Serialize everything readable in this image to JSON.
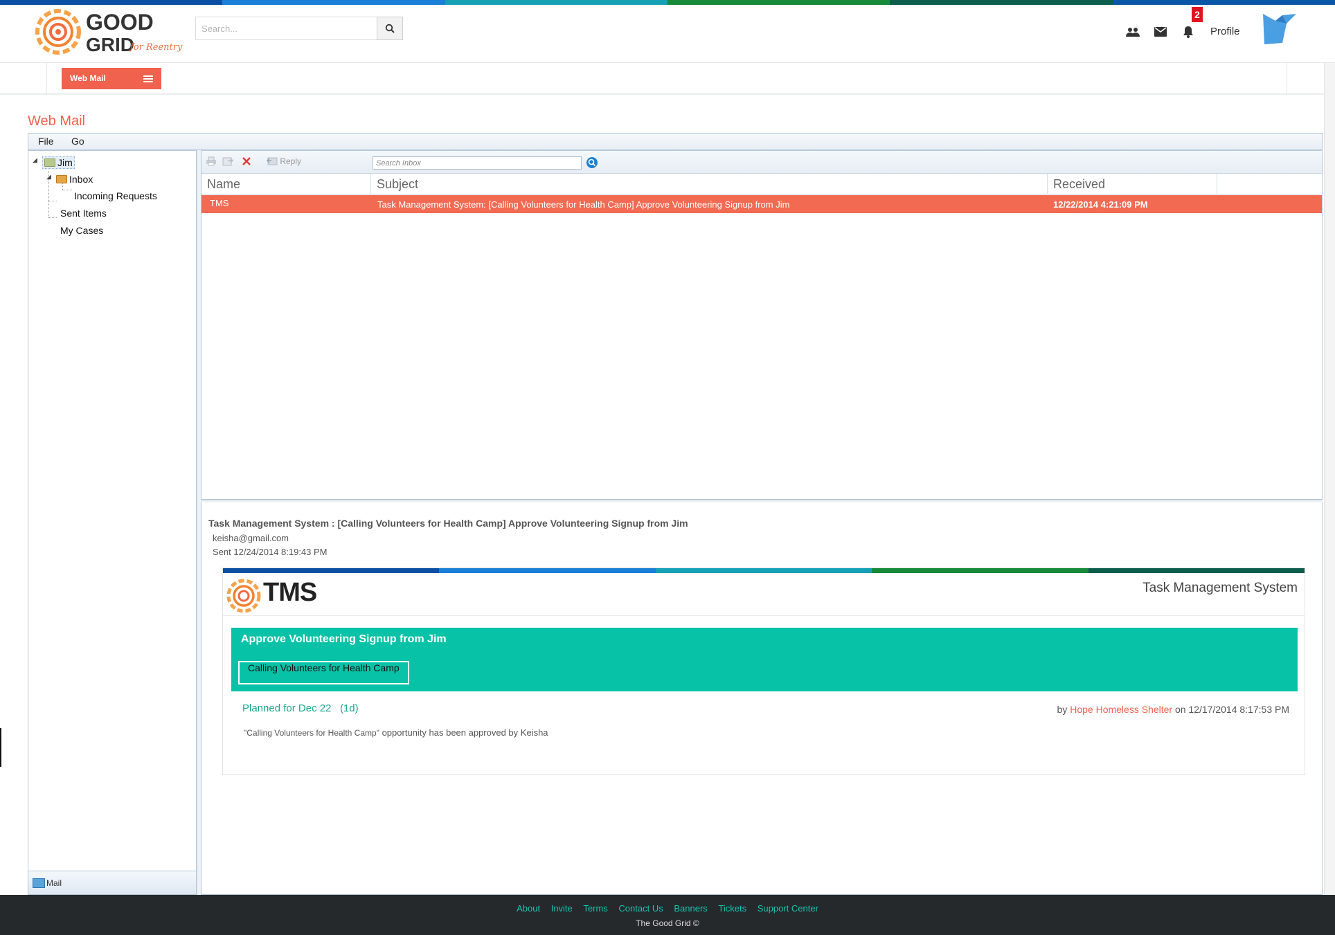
{
  "colors": {
    "stripe": [
      "#0b4fa3",
      "#1a7fd6",
      "#16a0b5",
      "#148a3a",
      "#0d5c4c",
      "#0b56a6"
    ],
    "accent": "#f0614e",
    "teal": "#08c2a7",
    "link_teal": "#19c4b0",
    "footer_bg": "#25292b"
  },
  "header": {
    "search_placeholder": "Search...",
    "notification_count": "2",
    "profile_label": "Profile",
    "icons": [
      "users-icon",
      "envelope-icon",
      "bell-icon",
      "bird-logo-icon"
    ]
  },
  "nav": {
    "webmail_tab": "Web Mail"
  },
  "page": {
    "title": "Web Mail"
  },
  "menu": {
    "file": "File",
    "go": "Go"
  },
  "tree": {
    "root": "Jim",
    "inbox": "Inbox",
    "incoming": "Incoming Requests",
    "sent": "Sent Items",
    "cases": "My Cases",
    "bottom_tab": "Mail"
  },
  "toolbar": {
    "reply": "Reply",
    "search_placeholder": "Search Inbox"
  },
  "grid": {
    "columns": [
      "Name",
      "Subject",
      "Received"
    ],
    "rows": [
      {
        "name": "TMS",
        "subject": "Task Management System: [Calling Volunteers for Health Camp] Approve Volunteering Signup from Jim",
        "received": "12/22/2014 4:21:09 PM"
      }
    ]
  },
  "preview": {
    "subject": "Task Management System : [Calling Volunteers for Health Camp] Approve Volunteering Signup from Jim",
    "from": "keisha@gmail.com",
    "sent": "Sent 12/24/2014 8:19:43 PM",
    "email": {
      "wordmark": "TMS",
      "system_title": "Task Management System",
      "banner_title": "Approve Volunteering Signup from Jim",
      "banner_tag": "Calling Volunteers for Health Camp",
      "planned": "Planned for Dec 22",
      "duration": "(1d)",
      "by_prefix": "by",
      "by_org": "Hope Homeless Shelter",
      "by_suffix": "on 12/17/2014 8:17:53 PM",
      "note_quoted": "\"Calling Volunteers for Health Camp\"",
      "note_rest": "opportunity has been approved by Keisha"
    }
  },
  "footer": {
    "links": [
      "About",
      "Invite",
      "Terms",
      "Contact Us",
      "Banners",
      "Tickets",
      "Support Center"
    ],
    "copyright": "The Good Grid ©"
  }
}
